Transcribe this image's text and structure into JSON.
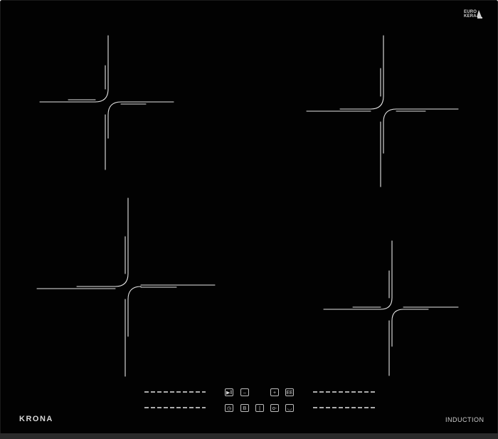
{
  "brand": {
    "logo_text": "KRONA"
  },
  "label": {
    "induction": "INDUCTION"
  },
  "certification": {
    "line1": "EURO",
    "line2": "KERA"
  },
  "colors": {
    "glass": "#020202",
    "markings": "#e8e8e8",
    "frame": "#2a2a2a"
  },
  "controls": {
    "top_row": [
      {
        "name": "play-pause-key",
        "glyph": "▶‖"
      },
      {
        "name": "minus-key",
        "glyph": "–"
      },
      {
        "name": "plus-key",
        "glyph": "+"
      },
      {
        "name": "power-boost-key",
        "glyph": "EE"
      }
    ],
    "bottom_row": [
      {
        "name": "timer-key",
        "glyph": "◷"
      },
      {
        "name": "booster-key",
        "glyph": "B"
      },
      {
        "name": "power-key",
        "glyph": "|"
      },
      {
        "name": "lock-key",
        "glyph": "o-"
      },
      {
        "name": "keep-warm-key",
        "glyph": "◡"
      }
    ]
  }
}
